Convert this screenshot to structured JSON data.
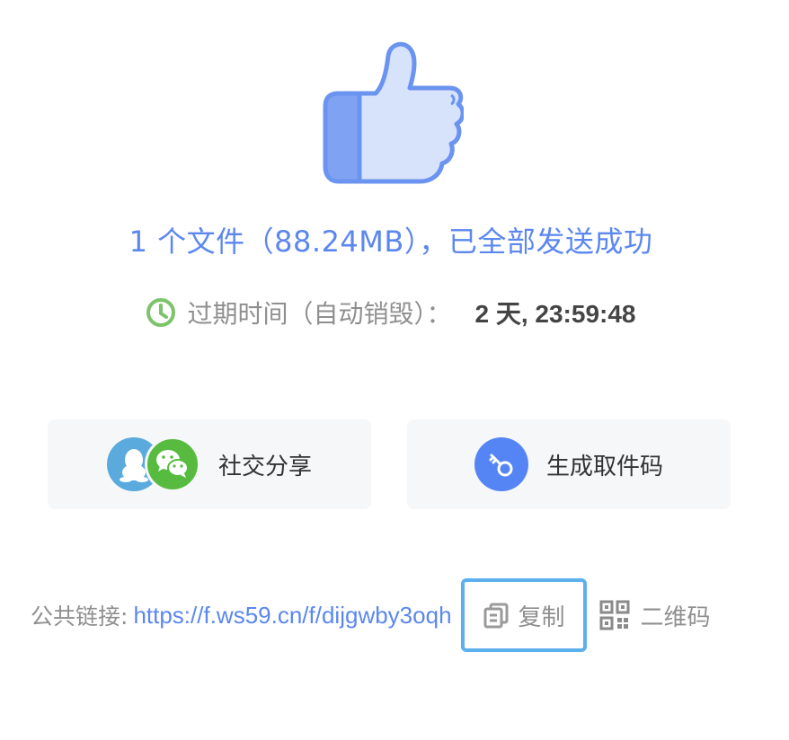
{
  "colors": {
    "accent": "#5b87ef",
    "clock": "#7cc36a",
    "copy_border": "#5cb0ee"
  },
  "result": {
    "headline": "1 个文件（88.24MB），已全部发送成功"
  },
  "expire": {
    "icon": "clock-icon",
    "label": "过期时间（自动销毁）：",
    "value": "2 天, 23:59:48"
  },
  "actions": {
    "share_label": "社交分享",
    "code_label": "生成取件码"
  },
  "public_link": {
    "label": "公共链接:",
    "url": "https://f.ws59.cn/f/dijgwby3oqh",
    "copy_label": "复制",
    "qr_label": "二维码"
  }
}
